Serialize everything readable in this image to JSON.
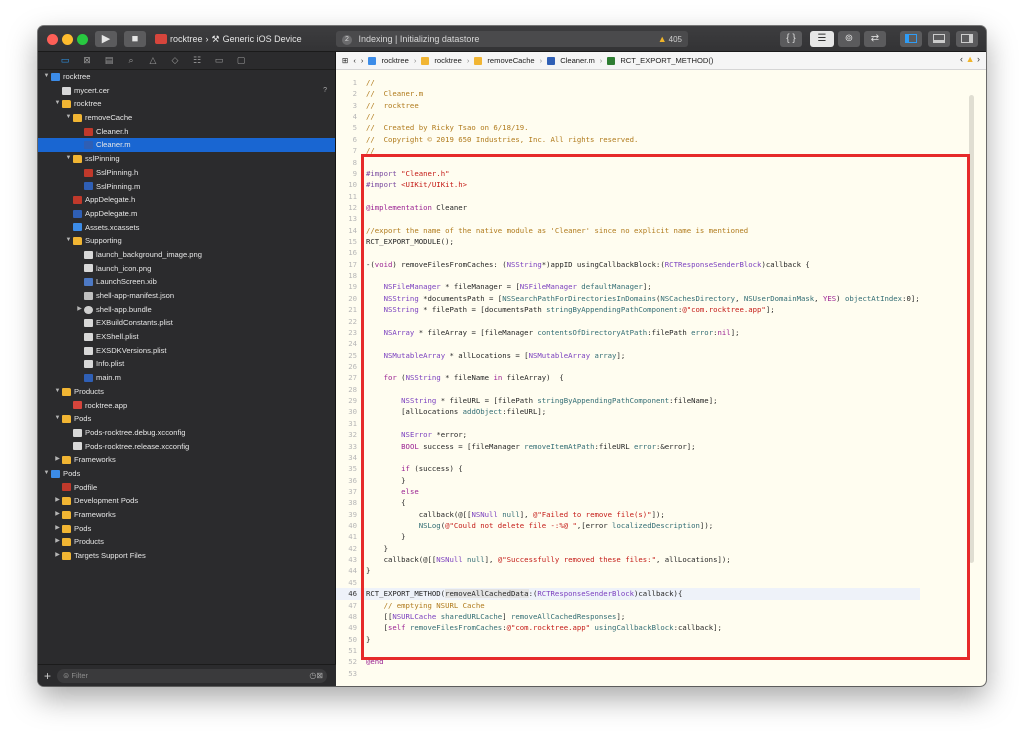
{
  "toolbar": {
    "scheme_app": "rocktree",
    "scheme_device": "Generic iOS Device",
    "activity_badge": "2",
    "activity_text": "Indexing | Initializing datastore",
    "warning_count": "405",
    "curly_label": "{ }"
  },
  "navigator": {
    "items": [
      {
        "label": "rocktree",
        "indent": 0,
        "disc": "▼",
        "icon": "blue"
      },
      {
        "label": "mycert.cer",
        "indent": 1,
        "disc": "",
        "icon": "file",
        "badge": "?"
      },
      {
        "label": "rocktree",
        "indent": 1,
        "disc": "▼",
        "icon": "folder"
      },
      {
        "label": "removeCache",
        "indent": 2,
        "disc": "▼",
        "icon": "folder"
      },
      {
        "label": "Cleaner.h",
        "indent": 3,
        "disc": "",
        "icon": "h"
      },
      {
        "label": "Cleaner.m",
        "indent": 3,
        "disc": "",
        "icon": "m",
        "selected": true
      },
      {
        "label": "sslPinning",
        "indent": 2,
        "disc": "▼",
        "icon": "folder"
      },
      {
        "label": "SslPinning.h",
        "indent": 3,
        "disc": "",
        "icon": "h"
      },
      {
        "label": "SslPinning.m",
        "indent": 3,
        "disc": "",
        "icon": "m"
      },
      {
        "label": "AppDelegate.h",
        "indent": 2,
        "disc": "",
        "icon": "h"
      },
      {
        "label": "AppDelegate.m",
        "indent": 2,
        "disc": "",
        "icon": "m"
      },
      {
        "label": "Assets.xcassets",
        "indent": 2,
        "disc": "",
        "icon": "blue"
      },
      {
        "label": "Supporting",
        "indent": 2,
        "disc": "▼",
        "icon": "folder"
      },
      {
        "label": "launch_background_image.png",
        "indent": 3,
        "disc": "",
        "icon": "file"
      },
      {
        "label": "launch_icon.png",
        "indent": 3,
        "disc": "",
        "icon": "file"
      },
      {
        "label": "LaunchScreen.xib",
        "indent": 3,
        "disc": "",
        "icon": "xib"
      },
      {
        "label": "shell-app-manifest.json",
        "indent": 3,
        "disc": "",
        "icon": "json"
      },
      {
        "label": "shell-app.bundle",
        "indent": 3,
        "disc": "▶",
        "icon": "bundle"
      },
      {
        "label": "EXBuildConstants.plist",
        "indent": 3,
        "disc": "",
        "icon": "file"
      },
      {
        "label": "EXShell.plist",
        "indent": 3,
        "disc": "",
        "icon": "file"
      },
      {
        "label": "EXSDKVersions.plist",
        "indent": 3,
        "disc": "",
        "icon": "file"
      },
      {
        "label": "Info.plist",
        "indent": 3,
        "disc": "",
        "icon": "file"
      },
      {
        "label": "main.m",
        "indent": 3,
        "disc": "",
        "icon": "m"
      },
      {
        "label": "Products",
        "indent": 1,
        "disc": "▼",
        "icon": "folder"
      },
      {
        "label": "rocktree.app",
        "indent": 2,
        "disc": "",
        "icon": "app"
      },
      {
        "label": "Pods",
        "indent": 1,
        "disc": "▼",
        "icon": "folder"
      },
      {
        "label": "Pods-rocktree.debug.xcconfig",
        "indent": 2,
        "disc": "",
        "icon": "file"
      },
      {
        "label": "Pods-rocktree.release.xcconfig",
        "indent": 2,
        "disc": "",
        "icon": "file"
      },
      {
        "label": "Frameworks",
        "indent": 1,
        "disc": "▶",
        "icon": "folder"
      },
      {
        "label": "Pods",
        "indent": 0,
        "disc": "▼",
        "icon": "blue"
      },
      {
        "label": "Podfile",
        "indent": 1,
        "disc": "",
        "icon": "pod"
      },
      {
        "label": "Development Pods",
        "indent": 1,
        "disc": "▶",
        "icon": "folder"
      },
      {
        "label": "Frameworks",
        "indent": 1,
        "disc": "▶",
        "icon": "folder"
      },
      {
        "label": "Pods",
        "indent": 1,
        "disc": "▶",
        "icon": "folder"
      },
      {
        "label": "Products",
        "indent": 1,
        "disc": "▶",
        "icon": "folder"
      },
      {
        "label": "Targets Support Files",
        "indent": 1,
        "disc": "▶",
        "icon": "folder"
      }
    ],
    "filter_placeholder": "Filter"
  },
  "jumpbar": {
    "crumbs": [
      "rocktree",
      "rocktree",
      "removeCache",
      "Cleaner.m",
      "RCT_EXPORT_METHOD()"
    ]
  },
  "editor": {
    "current_line": 46,
    "lines": [
      [
        [
          "c-cmt",
          "//"
        ]
      ],
      [
        [
          "c-cmt",
          "//  Cleaner.m"
        ]
      ],
      [
        [
          "c-cmt",
          "//  rocktree"
        ]
      ],
      [
        [
          "c-cmt",
          "//"
        ]
      ],
      [
        [
          "c-cmt",
          "//  Created by Ricky Tsao on 6/18/19."
        ]
      ],
      [
        [
          "c-cmt",
          "//  Copyright © 2019 650 Industries, Inc. All rights reserved."
        ]
      ],
      [
        [
          "c-cmt",
          "//"
        ]
      ],
      [
        [
          "",
          ""
        ]
      ],
      [
        [
          "c-pp",
          "#import "
        ],
        [
          "c-str",
          "\"Cleaner.h\""
        ]
      ],
      [
        [
          "c-pp",
          "#import "
        ],
        [
          "c-str",
          "<UIKit/UIKit.h>"
        ]
      ],
      [
        [
          "",
          ""
        ]
      ],
      [
        [
          "c-kw",
          "@implementation"
        ],
        [
          "",
          " Cleaner"
        ]
      ],
      [
        [
          "",
          ""
        ]
      ],
      [
        [
          "c-cmt",
          "//export the name of the native module as 'Cleaner' since no explicit name is mentioned"
        ]
      ],
      [
        [
          "",
          "RCT_EXPORT_MODULE();"
        ]
      ],
      [
        [
          "",
          ""
        ]
      ],
      [
        [
          "",
          "-("
        ],
        [
          "c-kw",
          "void"
        ],
        [
          "",
          ") removeFilesFromCaches: ("
        ],
        [
          "c-cls",
          "NSString"
        ],
        [
          "",
          "*)appID usingCallbackBlock:("
        ],
        [
          "c-cls",
          "RCTResponseSenderBlock"
        ],
        [
          "",
          ")callback {"
        ]
      ],
      [
        [
          "",
          ""
        ]
      ],
      [
        [
          "",
          "    "
        ],
        [
          "c-cls",
          "NSFileManager"
        ],
        [
          "",
          " * fileManager = ["
        ],
        [
          "c-cls",
          "NSFileManager"
        ],
        [
          "c-sel",
          " defaultManager"
        ],
        [
          "",
          "];"
        ]
      ],
      [
        [
          "",
          "    "
        ],
        [
          "c-cls",
          "NSString"
        ],
        [
          "",
          " *documentsPath = ["
        ],
        [
          "c-sel",
          "NSSearchPathForDirectoriesInDomains"
        ],
        [
          "",
          "("
        ],
        [
          "c-sel",
          "NSCachesDirectory"
        ],
        [
          "",
          ", "
        ],
        [
          "c-sel",
          "NSUserDomainMask"
        ],
        [
          "",
          ", "
        ],
        [
          "c-kw",
          "YES"
        ],
        [
          "",
          ") "
        ],
        [
          "c-sel",
          "objectAtIndex"
        ],
        [
          "",
          ":0];"
        ]
      ],
      [
        [
          "",
          "    "
        ],
        [
          "c-cls",
          "NSString"
        ],
        [
          "",
          " * filePath = [documentsPath "
        ],
        [
          "c-sel",
          "stringByAppendingPathComponent"
        ],
        [
          "",
          ":"
        ],
        [
          "c-str",
          "@\"com.rocktree.app\""
        ],
        [
          "",
          "];"
        ]
      ],
      [
        [
          "",
          ""
        ]
      ],
      [
        [
          "",
          "    "
        ],
        [
          "c-cls",
          "NSArray"
        ],
        [
          "",
          " * fileArray = [fileManager "
        ],
        [
          "c-sel",
          "contentsOfDirectoryAtPath"
        ],
        [
          "",
          ":filePath "
        ],
        [
          "c-sel",
          "error"
        ],
        [
          "",
          ":"
        ],
        [
          "c-kw",
          "nil"
        ],
        [
          "",
          "];"
        ]
      ],
      [
        [
          "",
          ""
        ]
      ],
      [
        [
          "",
          "    "
        ],
        [
          "c-cls",
          "NSMutableArray"
        ],
        [
          "",
          " * allLocations = ["
        ],
        [
          "c-cls",
          "NSMutableArray"
        ],
        [
          "c-sel",
          " array"
        ],
        [
          "",
          "];"
        ]
      ],
      [
        [
          "",
          ""
        ]
      ],
      [
        [
          "",
          "    "
        ],
        [
          "c-kw",
          "for"
        ],
        [
          "",
          " ("
        ],
        [
          "c-cls",
          "NSString"
        ],
        [
          "",
          " * fileName "
        ],
        [
          "c-kw",
          "in"
        ],
        [
          "",
          " fileArray)  {"
        ]
      ],
      [
        [
          "",
          ""
        ]
      ],
      [
        [
          "",
          "        "
        ],
        [
          "c-cls",
          "NSString"
        ],
        [
          "",
          " * fileURL = [filePath "
        ],
        [
          "c-sel",
          "stringByAppendingPathComponent"
        ],
        [
          "",
          ":fileName];"
        ]
      ],
      [
        [
          "",
          "        [allLocations "
        ],
        [
          "c-sel",
          "addObject"
        ],
        [
          "",
          ":fileURL];"
        ]
      ],
      [
        [
          "",
          ""
        ]
      ],
      [
        [
          "",
          "        "
        ],
        [
          "c-cls",
          "NSError"
        ],
        [
          "",
          " *error;"
        ]
      ],
      [
        [
          "",
          "        "
        ],
        [
          "c-kw",
          "BOOL"
        ],
        [
          "",
          " success = [fileManager "
        ],
        [
          "c-sel",
          "removeItemAtPath"
        ],
        [
          "",
          ":fileURL "
        ],
        [
          "c-sel",
          "error"
        ],
        [
          "",
          ":&error];"
        ]
      ],
      [
        [
          "",
          ""
        ]
      ],
      [
        [
          "",
          "        "
        ],
        [
          "c-kw",
          "if"
        ],
        [
          "",
          " (success) {"
        ]
      ],
      [
        [
          "",
          "        }"
        ]
      ],
      [
        [
          "",
          "        "
        ],
        [
          "c-kw",
          "else"
        ]
      ],
      [
        [
          "",
          "        {"
        ]
      ],
      [
        [
          "",
          "            callback(@[["
        ],
        [
          "c-cls",
          "NSNull"
        ],
        [
          "c-sel",
          " null"
        ],
        [
          "",
          "], "
        ],
        [
          "c-str",
          "@\"Failed to remove file(s)\""
        ],
        [
          "",
          "]);"
        ]
      ],
      [
        [
          "",
          "            "
        ],
        [
          "c-sel",
          "NSLog"
        ],
        [
          "",
          "("
        ],
        [
          "c-str",
          "@\"Could not delete file -:%@ \""
        ],
        [
          "",
          ",[error "
        ],
        [
          "c-sel",
          "localizedDescription"
        ],
        [
          "",
          "]);"
        ]
      ],
      [
        [
          "",
          "        }"
        ]
      ],
      [
        [
          "",
          "    }"
        ]
      ],
      [
        [
          "",
          "    callback(@[["
        ],
        [
          "c-cls",
          "NSNull"
        ],
        [
          "c-sel",
          " null"
        ],
        [
          "",
          "], "
        ],
        [
          "c-str",
          "@\"Successfully removed these files:\""
        ],
        [
          "",
          ", allLocations]);"
        ]
      ],
      [
        [
          "",
          "}"
        ]
      ],
      [
        [
          "",
          ""
        ]
      ],
      [
        [
          "",
          "RCT_EXPORT_METHOD("
        ],
        [
          "c-hl",
          "removeAllCachedData"
        ],
        [
          "",
          ":("
        ],
        [
          "c-cls",
          "RCTResponseSenderBlock"
        ],
        [
          "",
          ")callback){"
        ]
      ],
      [
        [
          "c-cmt",
          "    // emptying NSURL Cache"
        ]
      ],
      [
        [
          "",
          "    [["
        ],
        [
          "c-cls",
          "NSURLCache"
        ],
        [
          "c-sel",
          " sharedURLCache"
        ],
        [
          "",
          "] "
        ],
        [
          "c-sel",
          "removeAllCachedResponses"
        ],
        [
          "",
          "];"
        ]
      ],
      [
        [
          "",
          "    ["
        ],
        [
          "c-kw",
          "self"
        ],
        [
          "c-sel",
          " removeFilesFromCaches"
        ],
        [
          "",
          ":"
        ],
        [
          "c-str",
          "@\"com.rocktree.app\""
        ],
        [
          "c-sel",
          " usingCallbackBlock"
        ],
        [
          "",
          ":callback];"
        ]
      ],
      [
        [
          "",
          "}"
        ]
      ],
      [
        [
          "",
          ""
        ]
      ],
      [
        [
          "c-kw",
          "@end"
        ]
      ],
      [
        [
          "",
          ""
        ]
      ]
    ]
  }
}
